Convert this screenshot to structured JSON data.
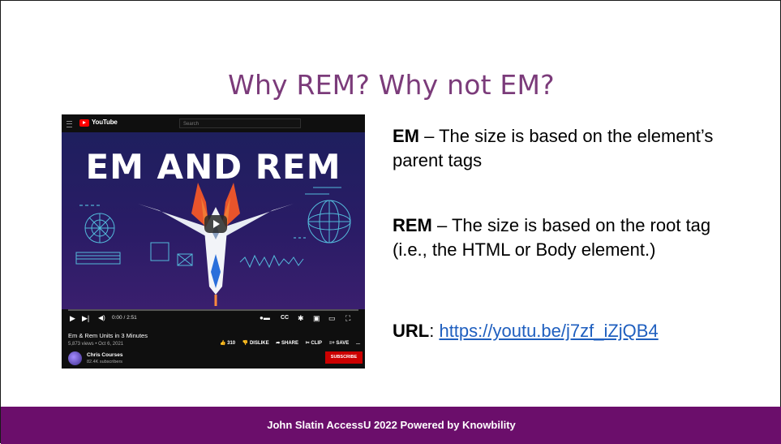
{
  "slide": {
    "title": "Why REM?  Why not EM?",
    "em_term": "EM",
    "em_desc": " – The size is based on the element’s parent tags",
    "rem_term": "REM",
    "rem_desc": " – The size is based on the root tag (i.e., the HTML or Body element.)",
    "url_label": "URL",
    "url_sep": ": ",
    "url": "https://youtu.be/j7zf_iZjQB4",
    "footer": "John Slatin AccessU 2022 Powered by Knowbility"
  },
  "video": {
    "brand": "YouTube",
    "search_placeholder": "Search",
    "thumbnail_text": "EM AND REM",
    "time": "0:00 / 2:51",
    "title": "Em & Rem Units in 3 Minutes",
    "views": "5,873 views • Oct 6, 2021",
    "likes": "310",
    "dislike": "DISLIKE",
    "share": "SHARE",
    "clip": "CLIP",
    "save": "SAVE",
    "more": "...",
    "channel": "Chris Courses",
    "subscribers": "82.4K subscribers",
    "subscribe": "SUBSCRIBE"
  },
  "colors": {
    "title": "#7b3b7a",
    "footer_bg": "#6b0e6b",
    "link": "#1f5fbf",
    "subscribe": "#cc0000"
  }
}
